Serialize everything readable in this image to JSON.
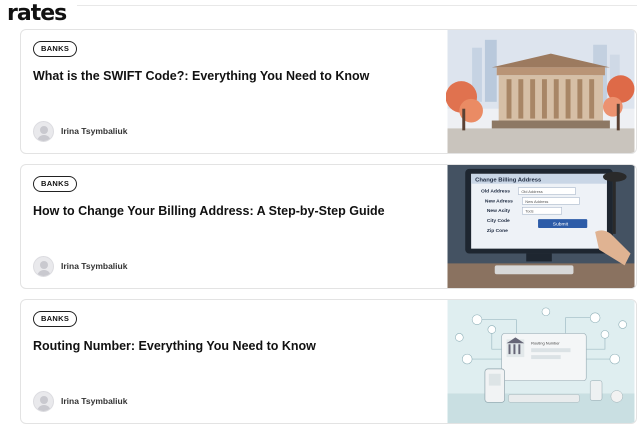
{
  "header": {
    "logo_text": "rates"
  },
  "articles": [
    {
      "tag": "BANKS",
      "title": "What is the SWIFT Code?: Everything You Need to Know",
      "author": "Irina Tsymbaliuk",
      "image_icon": "bank-building-illustration"
    },
    {
      "tag": "BANKS",
      "title": "How to Change Your Billing Address: A Step-by-Step Guide",
      "author": "Irina Tsymbaliuk",
      "image_icon": "billing-form-illustration",
      "image_text": {
        "heading": "Change Billing Address",
        "rows": [
          "Old Address",
          "New Adress",
          "New Acity",
          "City Code",
          "Zip Cone"
        ],
        "field_values": [
          "Old Address",
          "New Address",
          "Tods"
        ],
        "button": "Submit"
      }
    },
    {
      "tag": "BANKS",
      "title": "Routing Number: Everything You Need to Know",
      "author": "Irina Tsymbaliuk",
      "image_icon": "routing-network-illustration",
      "image_text": {
        "panel_heading": "Routing Number"
      }
    }
  ],
  "colors": {
    "text": "#111111",
    "border": "#e3e3e3",
    "tag_border": "#222222"
  }
}
